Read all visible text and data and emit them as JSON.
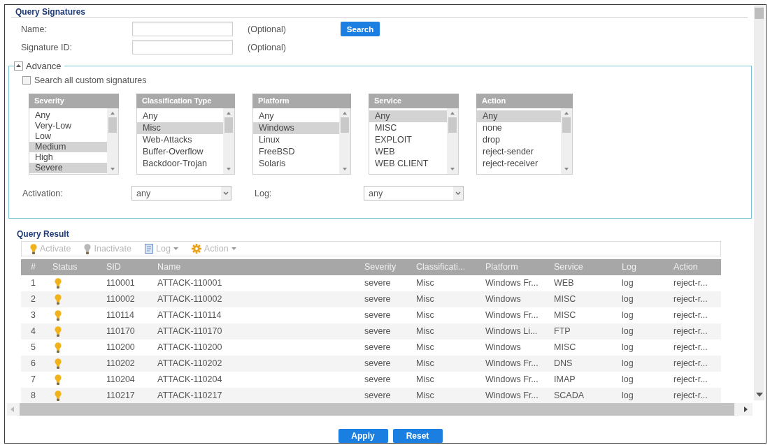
{
  "query_signatures": {
    "title": "Query Signatures",
    "fields": [
      {
        "label": "Name:",
        "hint": "(Optional)"
      },
      {
        "label": "Signature ID:",
        "hint": "(Optional)"
      }
    ],
    "search_button": "Search"
  },
  "advance": {
    "label": "Advance",
    "expanded": true,
    "search_all": {
      "label": "Search all custom signatures",
      "checked": false
    },
    "lists": [
      {
        "title": "Severity",
        "items": [
          {
            "label": "Any",
            "selected": false
          },
          {
            "label": "Very-Low",
            "selected": false
          },
          {
            "label": "Low",
            "selected": false
          },
          {
            "label": "Medium",
            "selected": true
          },
          {
            "label": "High",
            "selected": false
          },
          {
            "label": "Severe",
            "selected": true
          }
        ]
      },
      {
        "title": "Classification Type",
        "items": [
          {
            "label": "Any",
            "selected": false
          },
          {
            "label": "Misc",
            "selected": true
          },
          {
            "label": "Web-Attacks",
            "selected": false
          },
          {
            "label": "Buffer-Overflow",
            "selected": false
          },
          {
            "label": "Backdoor-Trojan",
            "selected": false
          }
        ]
      },
      {
        "title": "Platform",
        "items": [
          {
            "label": "Any",
            "selected": false
          },
          {
            "label": "Windows",
            "selected": true
          },
          {
            "label": "Linux",
            "selected": false
          },
          {
            "label": "FreeBSD",
            "selected": false
          },
          {
            "label": "Solaris",
            "selected": false
          }
        ]
      },
      {
        "title": "Service",
        "items": [
          {
            "label": "Any",
            "selected": true
          },
          {
            "label": "MISC",
            "selected": false
          },
          {
            "label": "EXPLOIT",
            "selected": false
          },
          {
            "label": "WEB",
            "selected": false
          },
          {
            "label": "WEB CLIENT",
            "selected": false
          }
        ]
      },
      {
        "title": "Action",
        "items": [
          {
            "label": "Any",
            "selected": true
          },
          {
            "label": "none",
            "selected": false
          },
          {
            "label": "drop",
            "selected": false
          },
          {
            "label": "reject-sender",
            "selected": false
          },
          {
            "label": "reject-receiver",
            "selected": false
          }
        ]
      }
    ],
    "filters": [
      {
        "label": "Activation:",
        "value": "any"
      },
      {
        "label": "Log:",
        "value": "any"
      }
    ]
  },
  "query_result": {
    "title": "Query Result",
    "toolbar": [
      {
        "kind": "activate",
        "label": "Activate",
        "disabled": true,
        "dropdown": false
      },
      {
        "kind": "inactivate",
        "label": "Inactivate",
        "disabled": true,
        "dropdown": false
      },
      {
        "kind": "log",
        "label": "Log",
        "disabled": true,
        "dropdown": true
      },
      {
        "kind": "action",
        "label": "Action",
        "disabled": true,
        "dropdown": true
      }
    ],
    "columns": [
      "#",
      "Status",
      "SID",
      "Name",
      "Severity",
      "Classificati...",
      "Platform",
      "Service",
      "Log",
      "Action"
    ],
    "rows": [
      {
        "index": "1",
        "active": true,
        "sid": "110001",
        "name": "ATTACK-110001",
        "severity": "severe",
        "classification": "Misc",
        "platform": "Windows Fr...",
        "service": "WEB",
        "log": "log",
        "action": "reject-r..."
      },
      {
        "index": "2",
        "active": true,
        "sid": "110002",
        "name": "ATTACK-110002",
        "severity": "severe",
        "classification": "Misc",
        "platform": "Windows",
        "service": "MISC",
        "log": "log",
        "action": "reject-r..."
      },
      {
        "index": "3",
        "active": true,
        "sid": "110114",
        "name": "ATTACK-110114",
        "severity": "severe",
        "classification": "Misc",
        "platform": "Windows Fr...",
        "service": "MISC",
        "log": "log",
        "action": "reject-r..."
      },
      {
        "index": "4",
        "active": true,
        "sid": "110170",
        "name": "ATTACK-110170",
        "severity": "severe",
        "classification": "Misc",
        "platform": "Windows Li...",
        "service": "FTP",
        "log": "log",
        "action": "reject-r..."
      },
      {
        "index": "5",
        "active": true,
        "sid": "110200",
        "name": "ATTACK-110200",
        "severity": "severe",
        "classification": "Misc",
        "platform": "Windows",
        "service": "MISC",
        "log": "log",
        "action": "reject-r..."
      },
      {
        "index": "6",
        "active": true,
        "sid": "110202",
        "name": "ATTACK-110202",
        "severity": "severe",
        "classification": "Misc",
        "platform": "Windows Fr...",
        "service": "DNS",
        "log": "log",
        "action": "reject-r..."
      },
      {
        "index": "7",
        "active": true,
        "sid": "110204",
        "name": "ATTACK-110204",
        "severity": "severe",
        "classification": "Misc",
        "platform": "Windows Fr...",
        "service": "IMAP",
        "log": "log",
        "action": "reject-r..."
      },
      {
        "index": "8",
        "active": true,
        "sid": "110217",
        "name": "ATTACK-110217",
        "severity": "severe",
        "classification": "Misc",
        "platform": "Windows Fr...",
        "service": "SCADA",
        "log": "log",
        "action": "reject-r..."
      }
    ]
  },
  "buttons": [
    "Apply",
    "Reset"
  ]
}
